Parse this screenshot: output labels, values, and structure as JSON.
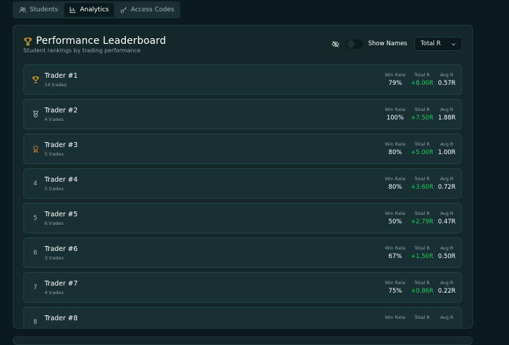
{
  "tabs": [
    {
      "label": "Students",
      "icon": "users-icon",
      "active": false
    },
    {
      "label": "Analytics",
      "icon": "bar-chart-icon",
      "active": true
    },
    {
      "label": "Access Codes",
      "icon": "key-icon",
      "active": false
    }
  ],
  "header": {
    "title": "Performance Leaderboard",
    "subtitle": "Student rankings by trading performance",
    "show_names_label": "Show Names",
    "sort_select": {
      "value": "Total R"
    }
  },
  "columns": {
    "win_rate": "Win Rate",
    "total_r": "Total R",
    "avg_r": "Avg R"
  },
  "colors": {
    "positive": "#22c55e",
    "gold": "#d4a12a",
    "silver": "#b7c0c3",
    "bronze": "#c7803a"
  },
  "leaderboard": [
    {
      "rank": "1",
      "medal": "trophy-icon",
      "name": "Trader #1",
      "trades": "14 trades",
      "win_rate": "79%",
      "total_r": "+8.00R",
      "avg_r": "0.57R"
    },
    {
      "rank": "2",
      "medal": "medal-icon",
      "name": "Trader #2",
      "trades": "4 trades",
      "win_rate": "100%",
      "total_r": "+7.50R",
      "avg_r": "1.88R"
    },
    {
      "rank": "3",
      "medal": "award-icon",
      "name": "Trader #3",
      "trades": "5 trades",
      "win_rate": "80%",
      "total_r": "+5.00R",
      "avg_r": "1.00R"
    },
    {
      "rank": "4",
      "medal": "",
      "name": "Trader #4",
      "trades": "5 trades",
      "win_rate": "80%",
      "total_r": "+3.60R",
      "avg_r": "0.72R"
    },
    {
      "rank": "5",
      "medal": "",
      "name": "Trader #5",
      "trades": "6 trades",
      "win_rate": "50%",
      "total_r": "+2.79R",
      "avg_r": "0.47R"
    },
    {
      "rank": "6",
      "medal": "",
      "name": "Trader #6",
      "trades": "3 trades",
      "win_rate": "67%",
      "total_r": "+1.50R",
      "avg_r": "0.50R"
    },
    {
      "rank": "7",
      "medal": "",
      "name": "Trader #7",
      "trades": "4 trades",
      "win_rate": "75%",
      "total_r": "+0.86R",
      "avg_r": "0.22R"
    },
    {
      "rank": "8",
      "medal": "",
      "name": "Trader #8",
      "trades": "",
      "win_rate": "",
      "total_r": "",
      "avg_r": ""
    }
  ]
}
